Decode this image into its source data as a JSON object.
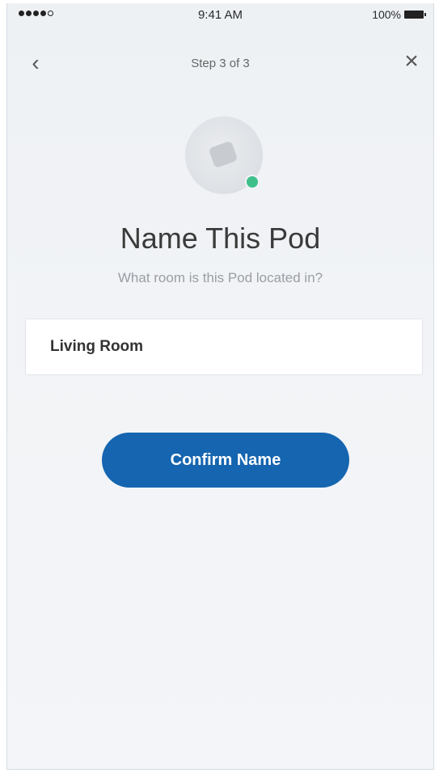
{
  "status_bar": {
    "time": "9:41 AM",
    "battery": "100%"
  },
  "nav": {
    "title": "Step 3 of 3",
    "back_icon": "chevron-left-icon",
    "close_icon": "close-icon"
  },
  "pod": {
    "icon": "pod-icon",
    "status_color": "#3fc08a"
  },
  "main": {
    "headline": "Name This Pod",
    "subtitle": "What room is this Pod located in?",
    "name_field_value": "Living Room",
    "confirm_label": "Confirm Name"
  },
  "colors": {
    "accent": "#1565b0",
    "background": "#f1f3f6"
  }
}
